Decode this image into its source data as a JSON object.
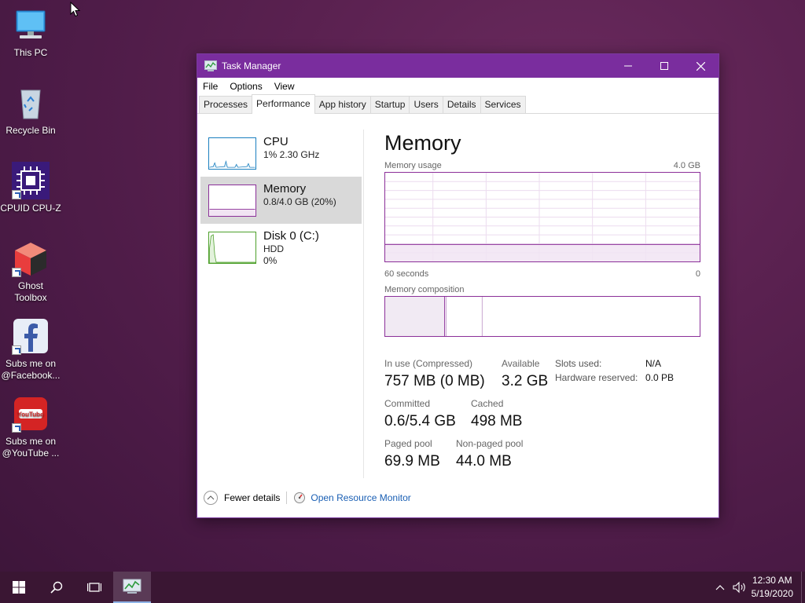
{
  "desktop": {
    "icons": [
      {
        "label": "This PC"
      },
      {
        "label": "Recycle Bin"
      },
      {
        "label": "CPUID CPU-Z"
      },
      {
        "label": "Ghost Toolbox"
      },
      {
        "label": "Subs me on @Facebook..."
      },
      {
        "label": "Subs me on @YouTube ..."
      }
    ]
  },
  "window": {
    "title": "Task Manager",
    "menu": [
      "File",
      "Options",
      "View"
    ],
    "tabs": [
      "Processes",
      "Performance",
      "App history",
      "Startup",
      "Users",
      "Details",
      "Services"
    ],
    "active_tab": "Performance"
  },
  "sidebar": {
    "items": [
      {
        "name": "CPU",
        "line1": "1%  2.30 GHz",
        "line2": ""
      },
      {
        "name": "Memory",
        "line1": "0.8/4.0 GB (20%)",
        "line2": ""
      },
      {
        "name": "Disk 0 (C:)",
        "line1": "HDD",
        "line2": "0%"
      }
    ]
  },
  "memory": {
    "title": "Memory",
    "usage_label": "Memory usage",
    "usage_max": "4.0 GB",
    "time_left": "60 seconds",
    "time_right": "0",
    "composition_label": "Memory composition",
    "in_use_label": "In use (Compressed)",
    "in_use_value": "757 MB (0 MB)",
    "available_label": "Available",
    "available_value": "3.2 GB",
    "committed_label": "Committed",
    "committed_value": "0.6/5.4 GB",
    "cached_label": "Cached",
    "cached_value": "498 MB",
    "paged_label": "Paged pool",
    "paged_value": "69.9 MB",
    "nonpaged_label": "Non-paged pool",
    "nonpaged_value": "44.0 MB",
    "slots_label": "Slots used:",
    "slots_value": "N/A",
    "hwres_label": "Hardware reserved:",
    "hwres_value": "0.0 PB"
  },
  "footer": {
    "fewer_details": "Fewer details",
    "resource_monitor": "Open Resource Monitor"
  },
  "taskbar": {
    "time": "12:30 AM",
    "date": "5/19/2020"
  },
  "colors": {
    "titlebar": "#7a2d9e",
    "memory_accent": "#8b2f99",
    "cpu_accent": "#1a7fbf",
    "disk_accent": "#4da02a",
    "link": "#1a5fb4"
  }
}
